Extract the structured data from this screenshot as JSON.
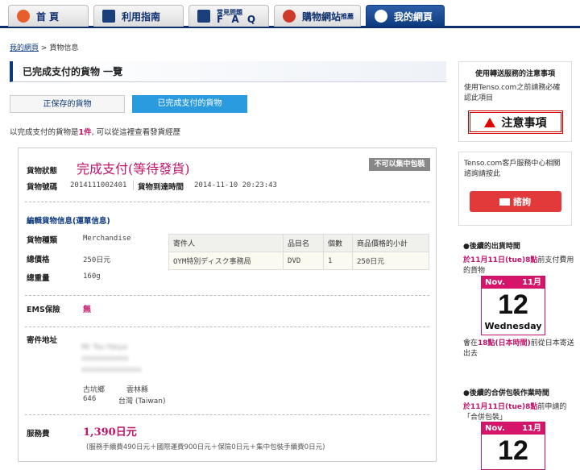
{
  "nav": {
    "tabs": [
      {
        "label": "首 頁",
        "color": "#e85d2c"
      },
      {
        "label": "利用指南",
        "color": "#1a3f7a"
      },
      {
        "small": "常見問題",
        "label": "F A Q",
        "color": "#1a3f7a"
      },
      {
        "label": "購物網站",
        "suffix": "推薦",
        "color": "#cc3b2a"
      },
      {
        "label": "我的網頁",
        "color": "#1a6fb8"
      }
    ]
  },
  "breadcrumb": {
    "home": "我的網頁",
    "sep": ">",
    "current": "貨物信息"
  },
  "page_title": "已完成支付的貨物 一覽",
  "subtabs": [
    "正保存的貨物",
    "已完成支付的貨物"
  ],
  "note": {
    "pre": "以完成支付的貨物是",
    "count": "1件",
    "post": ", 可以從這裡查看發貨經歷"
  },
  "detail": {
    "status_label": "貨物狀態",
    "status_value": "完成支付(等待發貨)",
    "badge": "不可以集中包裝",
    "number_label": "貨物號碼",
    "number_value": "2014111002401",
    "arrival_label": "貨物到達時間",
    "arrival_value": "2014-11-10 20:23:43",
    "edit_link": "編輯貨物信息(運單信息)",
    "type_label": "貨物種類",
    "type_value": "Merchandise",
    "price_label": "總價格",
    "price_value": "250日元",
    "weight_label": "總重量",
    "weight_value": "160g",
    "table": {
      "headers": [
        "寄件人",
        "品目名",
        "個數",
        "商品價格的小計"
      ],
      "rows": [
        [
          "OYM特別ディスク事務局",
          "DVD",
          "1",
          "250日元"
        ]
      ]
    },
    "ems_label": "EMS保險",
    "ems_value": "無",
    "address_label": "寄件地址",
    "addr_blur1": "Mr Tso Haiya",
    "addr_blur2": "xxxxxxxxxxx",
    "addr_blur3": "xxxxxxxxxxxxxx",
    "addr_township": "古坑鄉",
    "addr_county": "雲林縣",
    "addr_zip": "646",
    "addr_country": "台灣 (Taiwan)",
    "fee_label": "服務費",
    "fee_value": "1,390日元",
    "fee_breakdown": "(服務手續費490日元＋國際運費900日元＋保險0日元＋集中包裝手續費0日元)"
  },
  "sidebar": {
    "notice_title": "使用轉送服務的注意事項",
    "notice_text": "使用Tenso.com之前請務必確認此項目",
    "notice_button": "注意事項",
    "contact_text": "Tenso.com客戶服務中心相關諮詢請按此",
    "contact_button": "諮詢",
    "ship_title": "●後續的出貨時間",
    "ship_date": "於11月11日(tue)",
    "ship_hour": "8點",
    "ship_rest": "前支付費用的貨物",
    "cal1": {
      "month": "Nov.",
      "month_num": "11月",
      "day": "12",
      "weekday": "Wednesday"
    },
    "ship_after_pre": "會在",
    "ship_after_hl": "18點(日本時間)",
    "ship_after_post": "前從日本寄送出去",
    "pack_title": "●後續的合併包裝作業時間",
    "pack_date": "於11月11日(tue)",
    "pack_hour": "8點",
    "pack_rest": "前申請的「合併包裝」",
    "cal2": {
      "month": "Nov.",
      "month_num": "11月",
      "day": "12"
    }
  }
}
